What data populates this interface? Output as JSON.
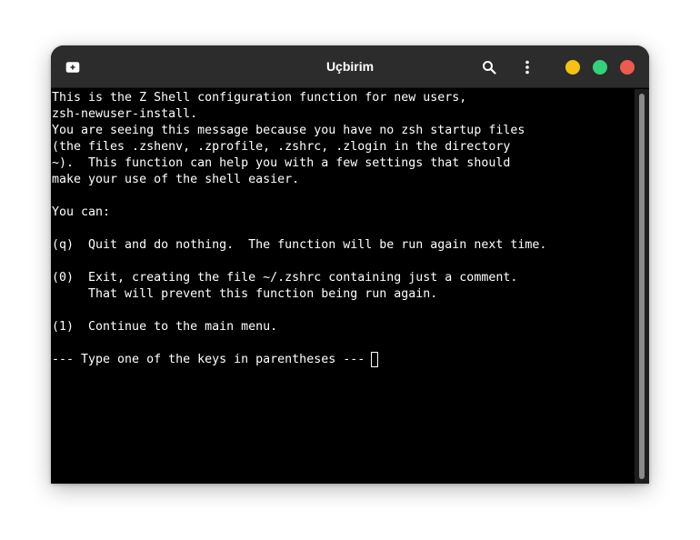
{
  "window": {
    "title": "Uçbirim"
  },
  "headerbar": {
    "new_tab_icon": "new-tab-icon",
    "search_icon": "search-icon",
    "menu_icon": "vertical-ellipsis-icon",
    "window_controls": {
      "minimize_color": "#f5c211",
      "maximize_color": "#33d17a",
      "close_color": "#ed5a4f"
    }
  },
  "terminal": {
    "lines": [
      "This is the Z Shell configuration function for new users,",
      "zsh-newuser-install.",
      "You are seeing this message because you have no zsh startup files",
      "(the files .zshenv, .zprofile, .zshrc, .zlogin in the directory",
      "~).  This function can help you with a few settings that should",
      "make your use of the shell easier.",
      "",
      "You can:",
      "",
      "(q)  Quit and do nothing.  The function will be run again next time.",
      "",
      "(0)  Exit, creating the file ~/.zshrc containing just a comment.",
      "     That will prevent this function being run again.",
      "",
      "(1)  Continue to the main menu.",
      "",
      "--- Type one of the keys in parentheses --- "
    ]
  }
}
